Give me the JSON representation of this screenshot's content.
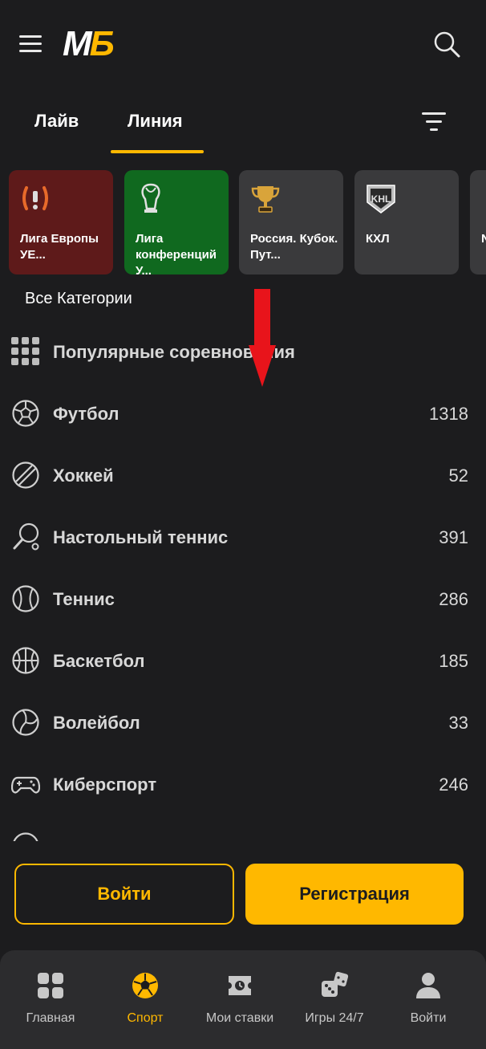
{
  "header": {
    "logo_m": "М",
    "logo_b": "Б",
    "icons": {
      "menu": "hamburger-icon",
      "search": "search-icon"
    }
  },
  "tabs": [
    {
      "label": "Лайв",
      "active": false
    },
    {
      "label": "Линия",
      "active": true
    }
  ],
  "cards": [
    {
      "label": "Лига Европы УЕ...",
      "icon": "europa-league-icon",
      "color": "#5e1a1a"
    },
    {
      "label": "Лига конференций У...",
      "icon": "conference-league-icon",
      "color": "#10691f"
    },
    {
      "label": "Россия. Кубок. Пут...",
      "icon": "trophy-icon",
      "color": "#3a3a3c"
    },
    {
      "label": "КХЛ",
      "icon": "khl-icon",
      "color": "#3a3a3c"
    },
    {
      "label": "N",
      "icon": "league-icon",
      "color": "#3a3a3c"
    }
  ],
  "all_categories_label": "Все Категории",
  "sports": [
    {
      "name": "Популярные соревнования",
      "count": "",
      "icon": "grid-icon"
    },
    {
      "name": "Футбол",
      "count": "1318",
      "icon": "soccer-ball-icon"
    },
    {
      "name": "Хоккей",
      "count": "52",
      "icon": "hockey-puck-icon"
    },
    {
      "name": "Настольный теннис",
      "count": "391",
      "icon": "table-tennis-icon"
    },
    {
      "name": "Теннис",
      "count": "286",
      "icon": "tennis-ball-icon"
    },
    {
      "name": "Баскетбол",
      "count": "185",
      "icon": "basketball-icon"
    },
    {
      "name": "Волейбол",
      "count": "33",
      "icon": "volleyball-icon"
    },
    {
      "name": "Киберспорт",
      "count": "246",
      "icon": "gamepad-icon"
    }
  ],
  "auth": {
    "login": "Войти",
    "register": "Регистрация"
  },
  "bottom_nav": [
    {
      "label": "Главная",
      "icon": "home-grid-icon",
      "active": false
    },
    {
      "label": "Спорт",
      "icon": "soccer-ball-icon",
      "active": true
    },
    {
      "label": "Мои ставки",
      "icon": "bet-ticket-icon",
      "active": false
    },
    {
      "label": "Игры 24/7",
      "icon": "dice-icon",
      "active": false
    },
    {
      "label": "Войти",
      "icon": "user-icon",
      "active": false
    }
  ],
  "colors": {
    "accent": "#ffb800",
    "background": "#1c1c1e",
    "nav_bg": "#2c2c2e",
    "arrow": "#e8141b"
  }
}
